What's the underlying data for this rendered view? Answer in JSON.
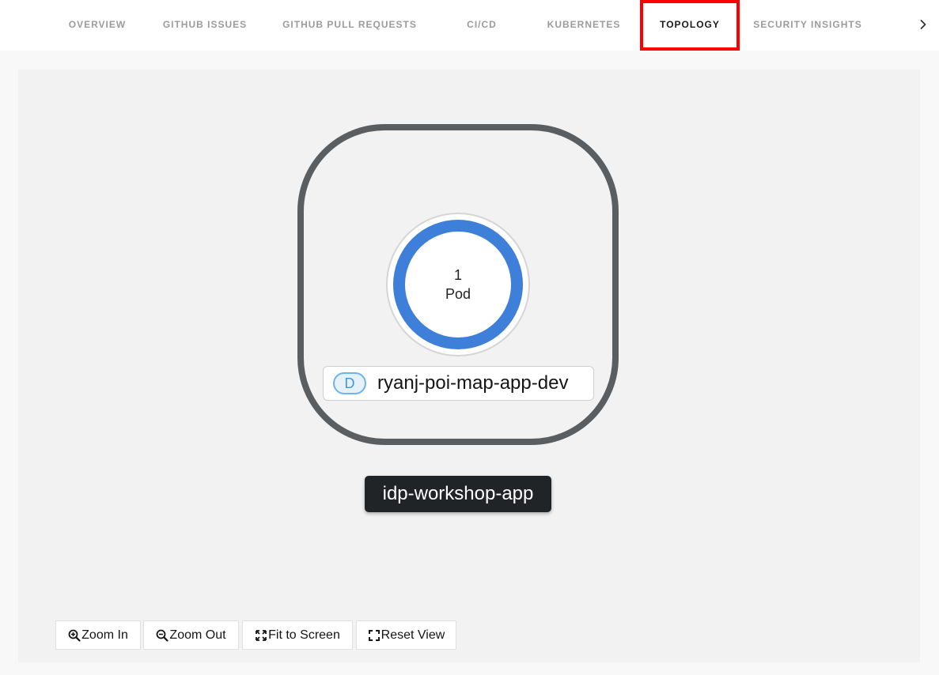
{
  "tabs": [
    {
      "label": "OVERVIEW"
    },
    {
      "label": "GITHUB ISSUES"
    },
    {
      "label": "GITHUB PULL REQUESTS"
    },
    {
      "label": "CI/CD"
    },
    {
      "label": "KUBERNETES"
    },
    {
      "label": "TOPOLOGY",
      "active": true
    },
    {
      "label": "SECURITY INSIGHTS"
    }
  ],
  "tab_scroll_icon": "chevron-right-icon",
  "topology": {
    "pod": {
      "count": "1",
      "unit": "Pod"
    },
    "deployment": {
      "badge": "D",
      "name": "ryanj-poi-map-app-dev"
    },
    "application": {
      "name": "idp-workshop-app"
    }
  },
  "controls": {
    "zoom_in": "Zoom In",
    "zoom_out": "Zoom Out",
    "fit_to_screen": "Fit to Screen",
    "reset_view": "Reset View"
  },
  "colors": {
    "active_highlight": "#ff0000",
    "pod_ring": "#3e7fd9",
    "group_border": "#5b5e61",
    "badge_border": "#6cb4ef"
  }
}
